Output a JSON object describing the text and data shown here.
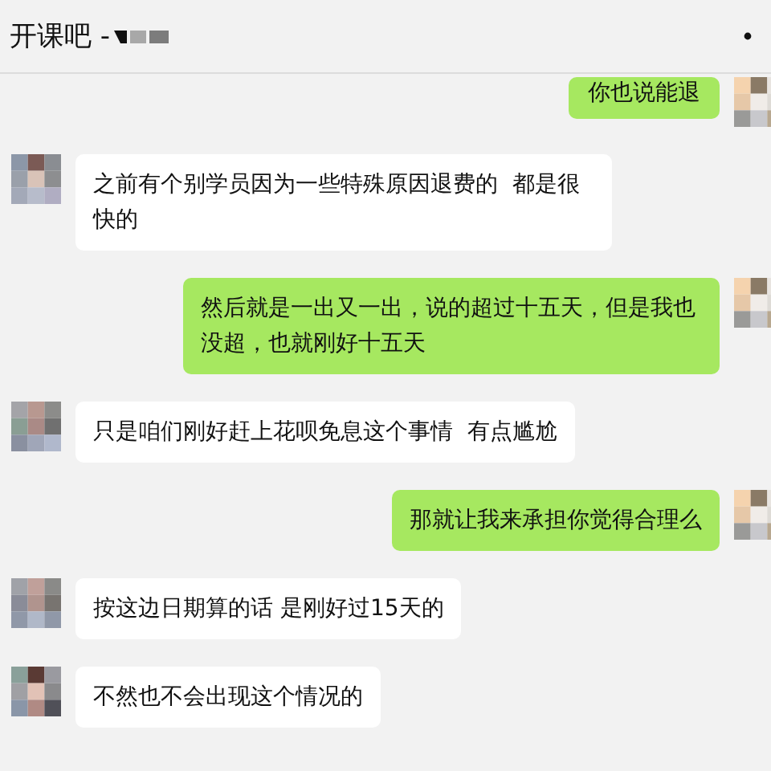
{
  "header": {
    "title": "开课吧 -"
  },
  "messages": [
    {
      "kind": "sent",
      "text": "你也说能退"
    },
    {
      "kind": "received",
      "text": "之前有个别学员因为一些特殊原因退费的  都是很快的"
    },
    {
      "kind": "sent",
      "text": "然后就是一出又一出，说的超过十五天，但是我也没超，也就刚好十五天"
    },
    {
      "kind": "received",
      "text": "只是咱们刚好赶上花呗免息这个事情  有点尴尬"
    },
    {
      "kind": "sent",
      "text": "那就让我来承担你觉得合理么"
    },
    {
      "kind": "received",
      "text": "按这边日期算的话 是刚好过15天的"
    },
    {
      "kind": "received",
      "text": "不然也不会出现这个情况的"
    }
  ]
}
